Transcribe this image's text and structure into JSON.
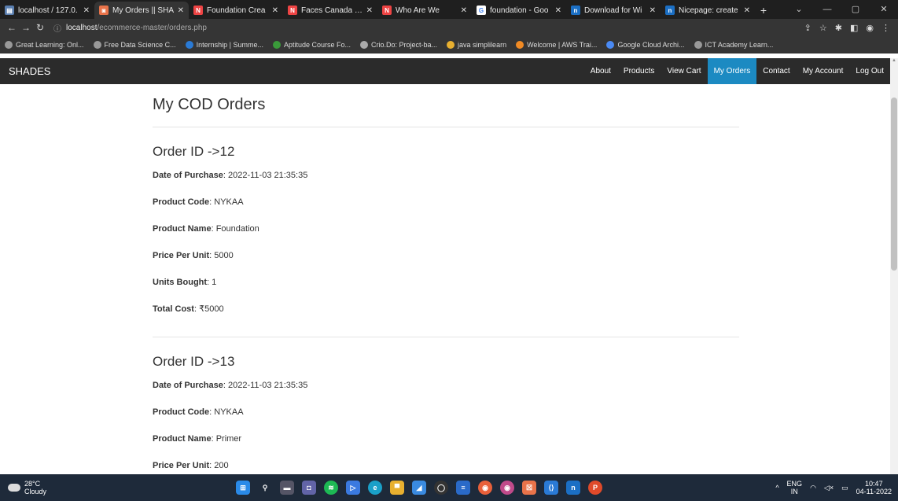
{
  "browser": {
    "tabs": [
      {
        "label": "localhost / 127.0.",
        "color": "#5a7fb0",
        "glyph": "▤"
      },
      {
        "label": "My Orders || SHA",
        "color": "#e8734a",
        "glyph": "◙"
      },
      {
        "label": "Foundation Crea",
        "color": "#e44",
        "glyph": "N"
      },
      {
        "label": "Faces Canada 3 I",
        "color": "#e44",
        "glyph": "N"
      },
      {
        "label": "Who Are We",
        "color": "#e44",
        "glyph": "N"
      },
      {
        "label": "foundation - Goo",
        "color": "#fff",
        "glyph": "G"
      },
      {
        "label": "Download for Wi",
        "color": "#1b6fc4",
        "glyph": "n"
      },
      {
        "label": "Nicepage: create",
        "color": "#1b6fc4",
        "glyph": "n"
      }
    ],
    "address": {
      "host": "localhost",
      "path": "/ecommerce-master/orders.php"
    },
    "bookmarks": [
      {
        "label": "Great Learning: Onl...",
        "color": "#999"
      },
      {
        "label": "Free Data Science C...",
        "color": "#999"
      },
      {
        "label": "Internship | Summe...",
        "color": "#2a7ad5"
      },
      {
        "label": "Aptitude Course Fo...",
        "color": "#3a9a3a"
      },
      {
        "label": "Crio.Do: Project-ba...",
        "color": "#aaa"
      },
      {
        "label": "java simplilearn",
        "color": "#e8b030"
      },
      {
        "label": "Welcome | AWS Trai...",
        "color": "#f08a24"
      },
      {
        "label": "Google Cloud Archi...",
        "color": "#4a8af4"
      },
      {
        "label": "ICT Academy Learn...",
        "color": "#999"
      }
    ]
  },
  "site": {
    "brand": "SHADES",
    "nav": [
      {
        "label": "About",
        "active": false
      },
      {
        "label": "Products",
        "active": false
      },
      {
        "label": "View Cart",
        "active": false
      },
      {
        "label": "My Orders",
        "active": true
      },
      {
        "label": "Contact",
        "active": false
      },
      {
        "label": "My Account",
        "active": false
      },
      {
        "label": "Log Out",
        "active": false
      }
    ]
  },
  "page": {
    "title": "My COD Orders",
    "labels": {
      "date": "Date of Purchase",
      "code": "Product Code",
      "name": "Product Name",
      "price": "Price Per Unit",
      "units": "Units Bought",
      "total": "Total Cost"
    },
    "orders": [
      {
        "heading": "Order ID ->12",
        "date": "2022-11-03 21:35:35",
        "code": "NYKAA",
        "name": "Foundation",
        "price": "5000",
        "units": "1",
        "total": "₹5000"
      },
      {
        "heading": "Order ID ->13",
        "date": "2022-11-03 21:35:35",
        "code": "NYKAA",
        "name": "Primer",
        "price": "200"
      }
    ]
  },
  "taskbar": {
    "temp": "28°C",
    "weather": "Cloudy",
    "lang": "ENG",
    "region": "IN",
    "time": "10:47",
    "date": "04-11-2022"
  }
}
